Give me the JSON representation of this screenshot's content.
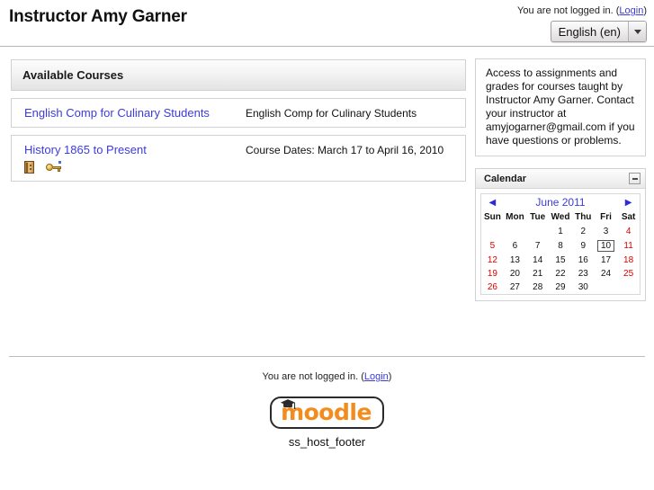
{
  "header": {
    "site_title": "Instructor Amy Garner",
    "login_status_text": "You are not logged in. (",
    "login_link": "Login",
    "login_status_close": ")",
    "language_selected": "English (en)",
    "language_icon": "chevron-down-icon"
  },
  "courses_block": {
    "heading": "Available Courses",
    "items": [
      {
        "name": "English Comp for Culinary Students",
        "summary": "English Comp for Culinary Students",
        "icons": []
      },
      {
        "name": "History 1865 to Present",
        "summary": "Course Dates: March 17 to April 16, 2010",
        "icons": [
          "summary-icon",
          "enrolment-key-icon"
        ]
      }
    ]
  },
  "sidebar": {
    "info_block": {
      "text": "Access to assignments and grades for courses taught by Instructor Amy Garner. Contact your instructor at amyjogarner@gmail.com if you have questions or problems."
    },
    "calendar_block": {
      "title": "Calendar",
      "hide_icon": "minus-icon",
      "prev_icon": "triangle-left-icon",
      "next_icon": "triangle-right-icon",
      "month_label": "June 2011",
      "daynames": [
        "Sun",
        "Mon",
        "Tue",
        "Wed",
        "Thu",
        "Fri",
        "Sat"
      ],
      "weeks": [
        [
          {
            "d": "",
            "type": "empty"
          },
          {
            "d": "",
            "type": "empty"
          },
          {
            "d": "",
            "type": "empty"
          },
          {
            "d": "1",
            "type": "weekday"
          },
          {
            "d": "2",
            "type": "weekday"
          },
          {
            "d": "3",
            "type": "weekday"
          },
          {
            "d": "4",
            "type": "weekend"
          }
        ],
        [
          {
            "d": "5",
            "type": "weekend"
          },
          {
            "d": "6",
            "type": "weekday"
          },
          {
            "d": "7",
            "type": "weekday"
          },
          {
            "d": "8",
            "type": "weekday"
          },
          {
            "d": "9",
            "type": "weekday"
          },
          {
            "d": "10",
            "type": "today"
          },
          {
            "d": "11",
            "type": "weekend"
          }
        ],
        [
          {
            "d": "12",
            "type": "weekend"
          },
          {
            "d": "13",
            "type": "weekday"
          },
          {
            "d": "14",
            "type": "weekday"
          },
          {
            "d": "15",
            "type": "weekday"
          },
          {
            "d": "16",
            "type": "weekday"
          },
          {
            "d": "17",
            "type": "weekday"
          },
          {
            "d": "18",
            "type": "weekend"
          }
        ],
        [
          {
            "d": "19",
            "type": "weekend"
          },
          {
            "d": "20",
            "type": "weekday"
          },
          {
            "d": "21",
            "type": "weekday"
          },
          {
            "d": "22",
            "type": "weekday"
          },
          {
            "d": "23",
            "type": "weekday"
          },
          {
            "d": "24",
            "type": "weekday"
          },
          {
            "d": "25",
            "type": "weekend"
          }
        ],
        [
          {
            "d": "26",
            "type": "weekend"
          },
          {
            "d": "27",
            "type": "weekday"
          },
          {
            "d": "28",
            "type": "weekday"
          },
          {
            "d": "29",
            "type": "weekday"
          },
          {
            "d": "30",
            "type": "weekday"
          },
          {
            "d": "",
            "type": "empty"
          },
          {
            "d": "",
            "type": "empty"
          }
        ]
      ]
    }
  },
  "footer": {
    "login_status_text": "You are not logged in. (",
    "login_link": "Login",
    "login_status_close": ")",
    "logo_text": "moodle",
    "logo_icon": "graduation-cap-icon",
    "hostname": "ss_host_footer"
  },
  "colors": {
    "link": "#3b3bdf",
    "weekend": "#d90000",
    "logo_orange": "#f28c1c",
    "border": "#d2d2d2"
  }
}
